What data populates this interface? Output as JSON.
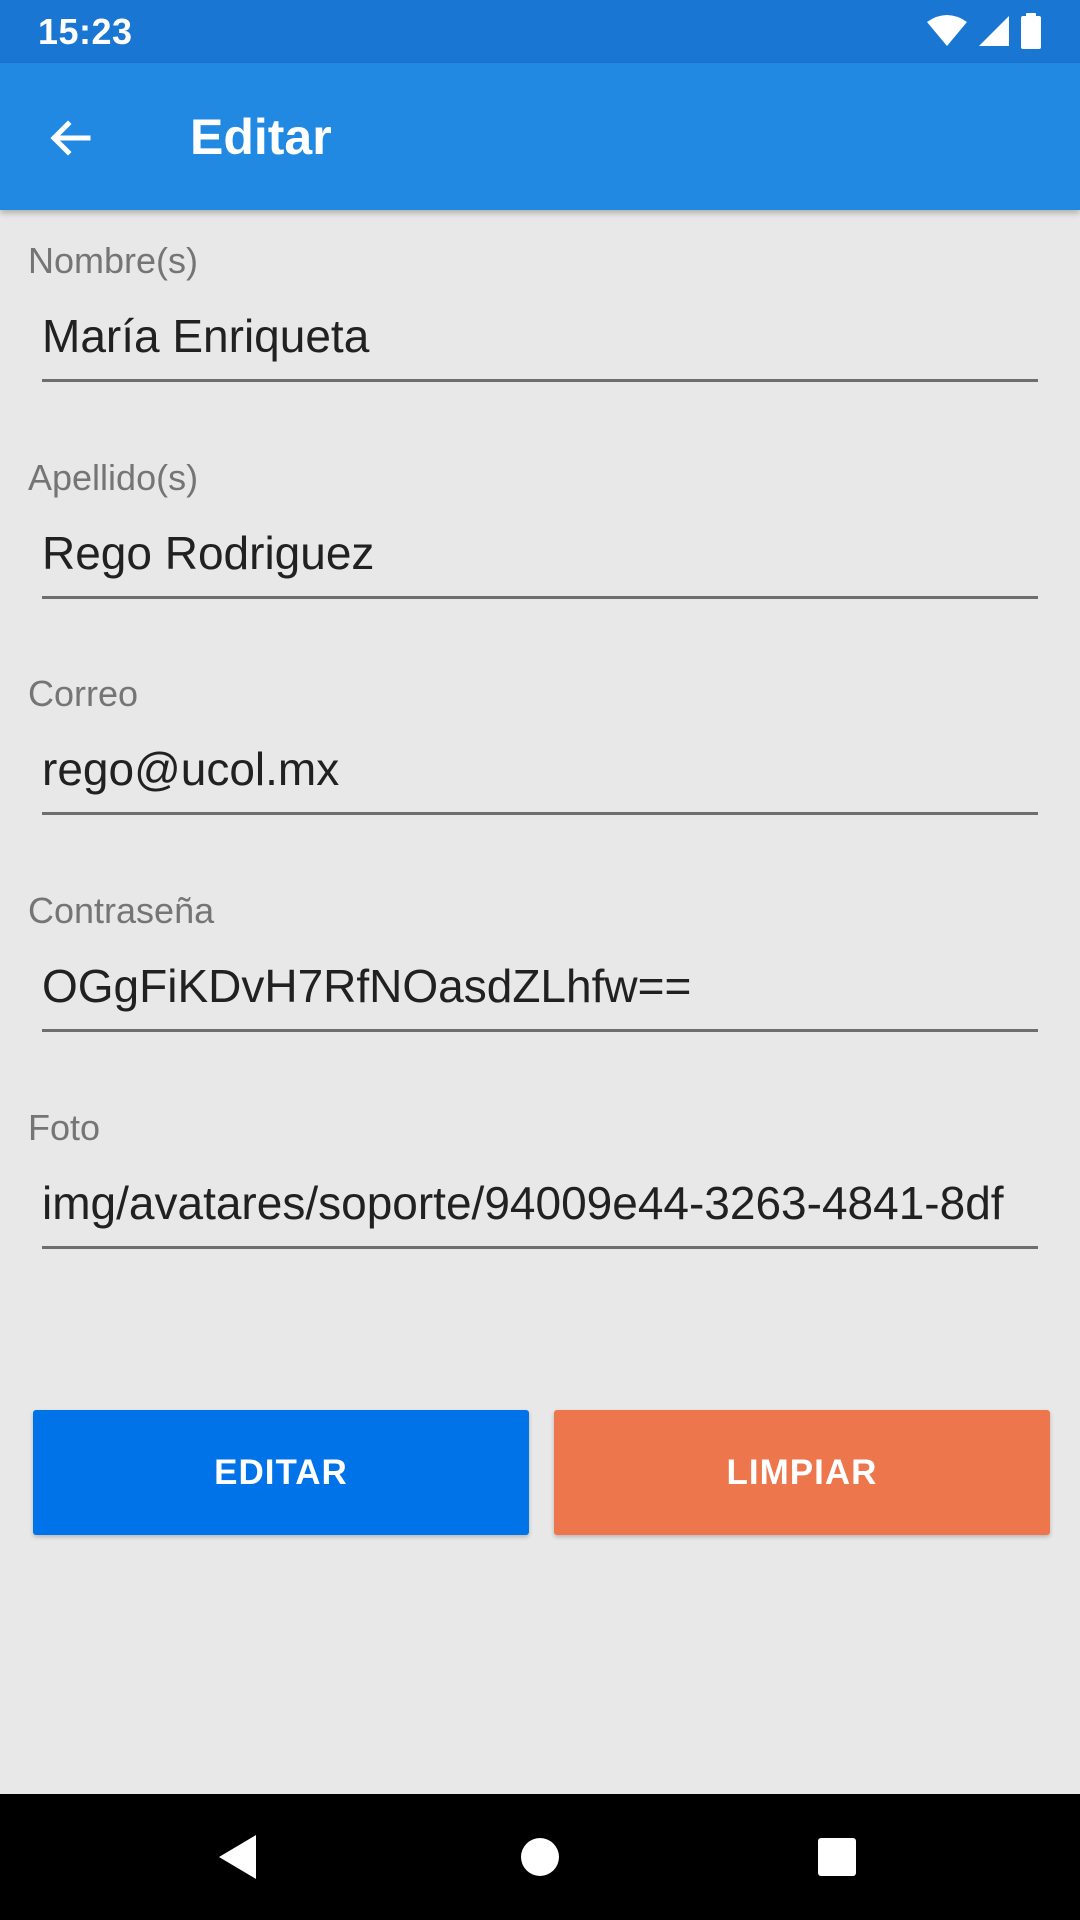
{
  "status_bar": {
    "time": "15:23",
    "icons": [
      "wifi-icon",
      "cell-signal-icon",
      "battery-icon"
    ]
  },
  "app_bar": {
    "title": "Editar",
    "back_icon": "arrow-back-icon"
  },
  "form": {
    "fields": [
      {
        "label": "Nombre(s)",
        "value": "María Enriqueta"
      },
      {
        "label": "Apellido(s)",
        "value": "Rego Rodriguez"
      },
      {
        "label": "Correo",
        "value": "rego@ucol.mx"
      },
      {
        "label": "Contraseña",
        "value": "OGgFiKDvH7RfNOasdZLhfw=="
      },
      {
        "label": "Foto",
        "value": "img/avatares/soporte/94009e44-3263-4841-8df"
      }
    ]
  },
  "buttons": {
    "edit_label": "EDITAR",
    "clear_label": "LIMPIAR"
  },
  "colors": {
    "status_bar": "#1976D2",
    "app_bar": "#2289E2",
    "edit_button": "#0073E9",
    "clear_button": "#EE764D",
    "background": "#E8E8E8"
  },
  "nav_bar": {
    "icons": [
      "nav-back-icon",
      "nav-home-icon",
      "nav-recents-icon"
    ]
  }
}
